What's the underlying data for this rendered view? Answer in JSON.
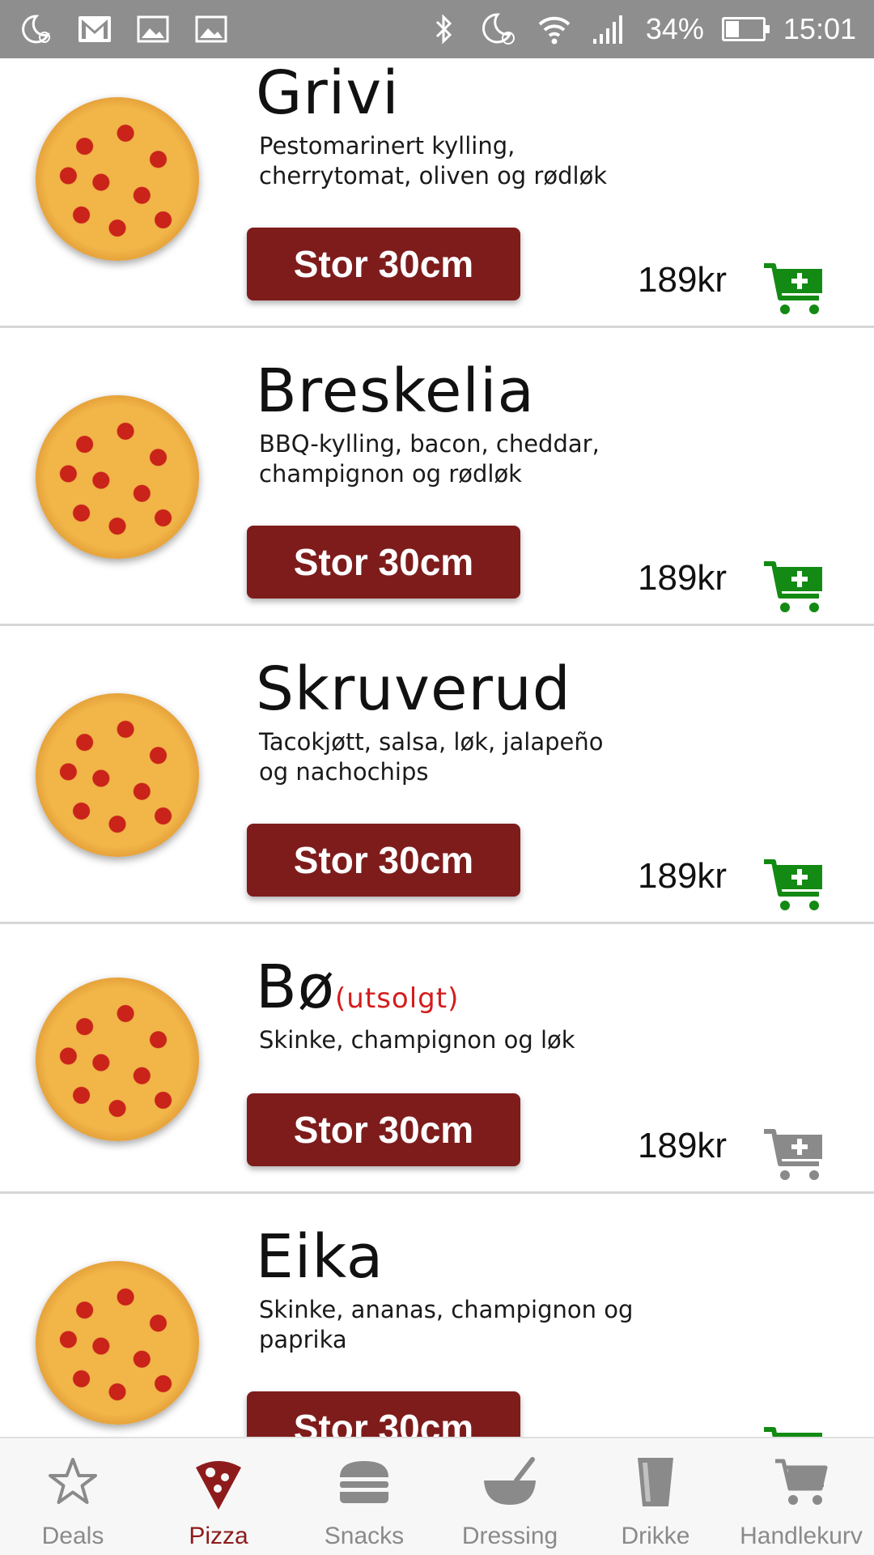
{
  "status_bar": {
    "battery": "34%",
    "time": "15:01",
    "battery_level": 0.34
  },
  "items": [
    {
      "name": "Grivi",
      "soldout": "",
      "description": "Pestomarinert kylling, cherrytomat, oliven og rødløk",
      "size": "Stor 30cm",
      "price": "189kr",
      "available": true
    },
    {
      "name": "Breskelia",
      "soldout": "",
      "description": "BBQ-kylling, bacon, cheddar, champignon og rødløk",
      "size": "Stor 30cm",
      "price": "189kr",
      "available": true
    },
    {
      "name": "Skruverud",
      "soldout": "",
      "description": "Tacokjøtt, salsa, løk, jalapeño og nachochips",
      "size": "Stor 30cm",
      "price": "189kr",
      "available": true
    },
    {
      "name": "Bø",
      "soldout": "(utsolgt)",
      "description": "Skinke, champignon og løk",
      "size": "Stor 30cm",
      "price": "189kr",
      "available": false
    },
    {
      "name": "Eika",
      "soldout": "",
      "description": "Skinke, ananas, champignon og paprika",
      "size": "Stor 30cm",
      "price": "",
      "available": true
    }
  ],
  "nav": [
    {
      "label": "Deals",
      "icon": "star-icon"
    },
    {
      "label": "Pizza",
      "icon": "pizza-icon",
      "active": true
    },
    {
      "label": "Snacks",
      "icon": "burger-icon"
    },
    {
      "label": "Dressing",
      "icon": "bowl-icon"
    },
    {
      "label": "Drikke",
      "icon": "glass-icon"
    },
    {
      "label": "Handlekurv",
      "icon": "cart-icon"
    }
  ],
  "colors": {
    "button": "#7e1c1c",
    "cart_available": "#138a13",
    "cart_unavailable": "#8a8a8a",
    "soldout": "#d41c1c",
    "nav_active": "#8e1b1b",
    "nav_inactive": "#8a8a8a"
  }
}
